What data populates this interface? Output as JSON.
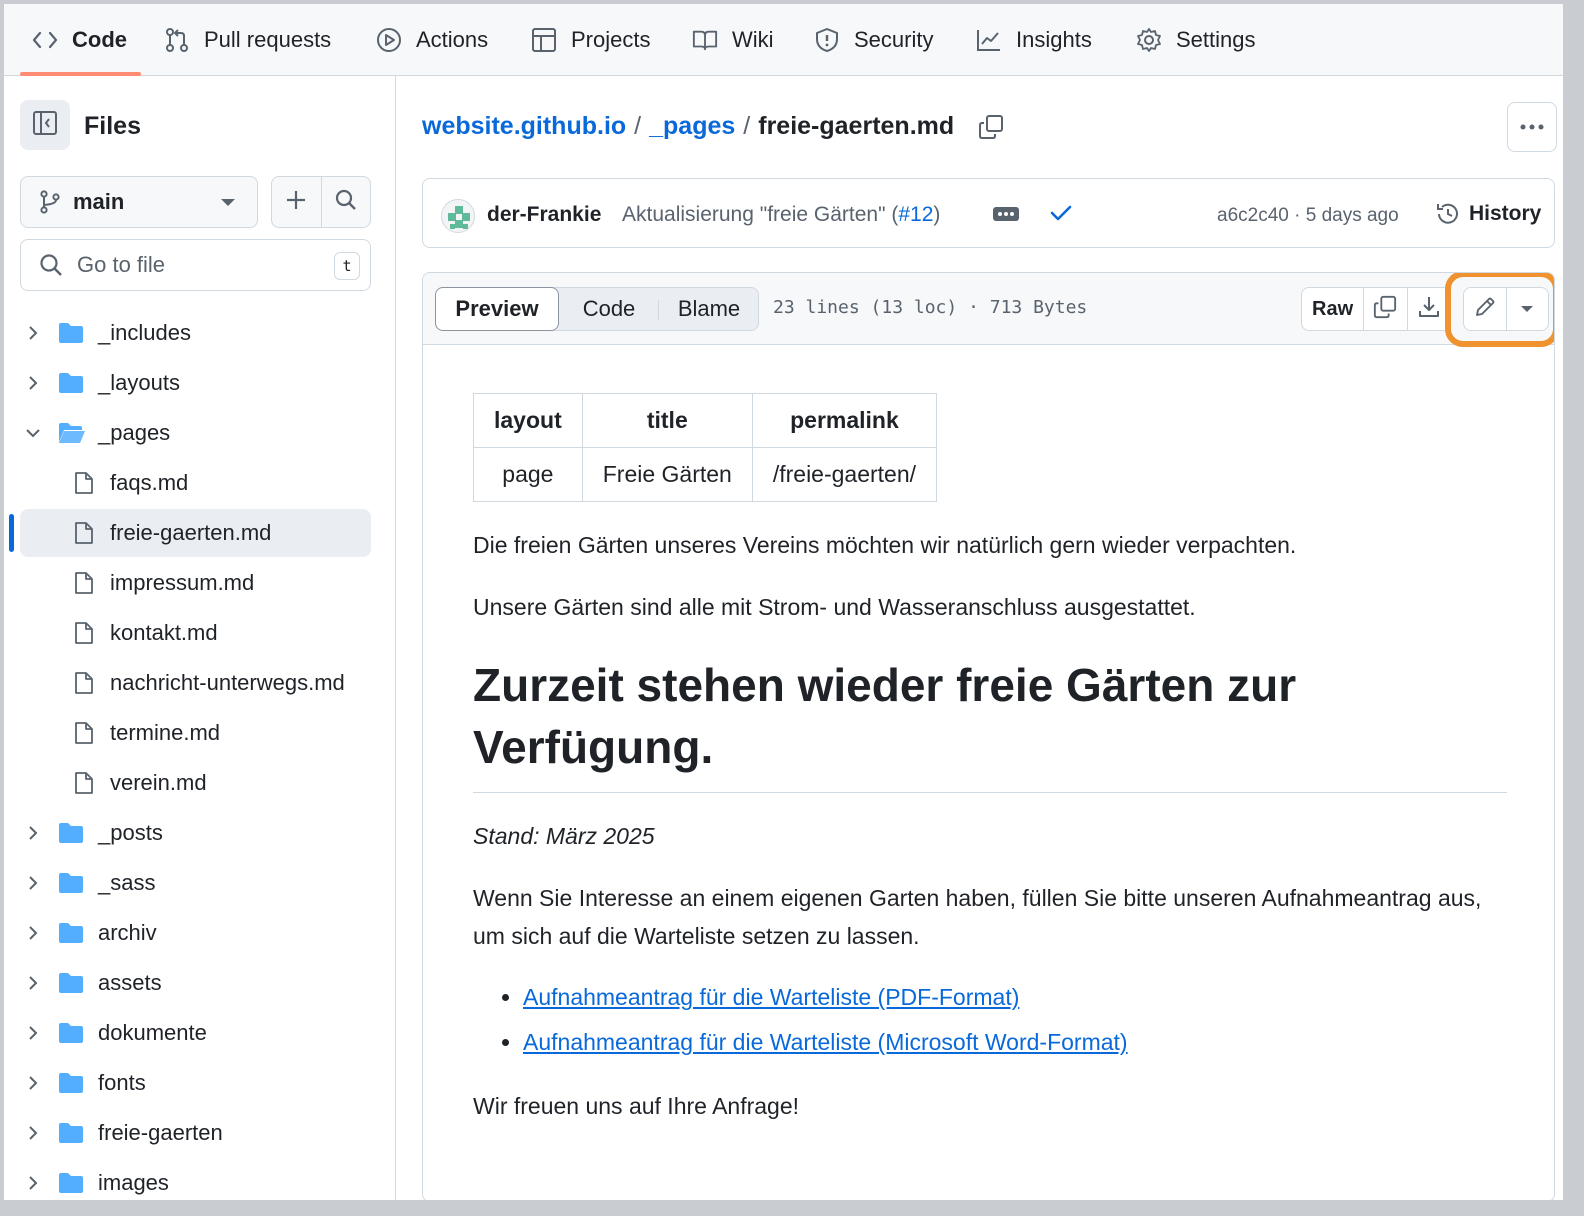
{
  "topnav": {
    "tabs": [
      {
        "label": "Code",
        "icon": "code-icon"
      },
      {
        "label": "Pull requests",
        "icon": "pull-request-icon"
      },
      {
        "label": "Actions",
        "icon": "play-icon"
      },
      {
        "label": "Projects",
        "icon": "table-icon"
      },
      {
        "label": "Wiki",
        "icon": "book-icon"
      },
      {
        "label": "Security",
        "icon": "shield-icon"
      },
      {
        "label": "Insights",
        "icon": "graph-icon"
      },
      {
        "label": "Settings",
        "icon": "gear-icon"
      }
    ]
  },
  "sidebar": {
    "title": "Files",
    "branch": "main",
    "search_placeholder": "Go to file",
    "search_shortcut": "t",
    "tree": [
      {
        "name": "_includes",
        "type": "folder",
        "expanded": false
      },
      {
        "name": "_layouts",
        "type": "folder",
        "expanded": false
      },
      {
        "name": "_pages",
        "type": "folder",
        "expanded": true
      },
      {
        "name": "faqs.md",
        "type": "file"
      },
      {
        "name": "freie-gaerten.md",
        "type": "file",
        "selected": true
      },
      {
        "name": "impressum.md",
        "type": "file"
      },
      {
        "name": "kontakt.md",
        "type": "file"
      },
      {
        "name": "nachricht-unterwegs.md",
        "type": "file"
      },
      {
        "name": "termine.md",
        "type": "file"
      },
      {
        "name": "verein.md",
        "type": "file"
      },
      {
        "name": "_posts",
        "type": "folder",
        "expanded": false
      },
      {
        "name": "_sass",
        "type": "folder",
        "expanded": false
      },
      {
        "name": "archiv",
        "type": "folder",
        "expanded": false
      },
      {
        "name": "assets",
        "type": "folder",
        "expanded": false
      },
      {
        "name": "dokumente",
        "type": "folder",
        "expanded": false
      },
      {
        "name": "fonts",
        "type": "folder",
        "expanded": false
      },
      {
        "name": "freie-gaerten",
        "type": "folder",
        "expanded": false
      },
      {
        "name": "images",
        "type": "folder",
        "expanded": false
      }
    ]
  },
  "breadcrumb": {
    "repo": "website.github.io",
    "sep": "/",
    "folder": "_pages",
    "file": "freie-gaerten.md"
  },
  "commit": {
    "author": "der-Frankie",
    "message_prefix": "Aktualisierung \"freie Gärten\" (",
    "pr_link": "#12",
    "message_suffix": ")",
    "meta": "a6c2c40 · 5 days ago",
    "history_label": "History"
  },
  "file": {
    "tabs": [
      "Preview",
      "Code",
      "Blame"
    ],
    "info": "23 lines (13 loc) · 713 Bytes",
    "raw_label": "Raw"
  },
  "content": {
    "frontmatter": {
      "headers": [
        "layout",
        "title",
        "permalink"
      ],
      "values": [
        "page",
        "Freie Gärten",
        "/freie-gaerten/"
      ]
    },
    "p1": "Die freien Gärten unseres Vereins möchten wir natürlich gern wieder verpachten.",
    "p2": "Unsere Gärten sind alle mit Strom- und Wasseranschluss ausgestattet.",
    "heading": "Zurzeit stehen wieder freie Gärten zur Verfügung.",
    "stand": "Stand: März 2025",
    "p3": "Wenn Sie Interesse an einem eigenen Garten haben, füllen Sie bitte unseren Aufnahmeantrag aus, um sich auf die Warteliste setzen zu lassen.",
    "links": [
      "Aufnahmeantrag für die Warteliste (PDF-Format)",
      "Aufnahmeantrag für die Warteliste (Microsoft Word-Format)"
    ],
    "p4": "Wir freuen uns auf Ihre Anfrage!"
  },
  "colors": {
    "accent_link": "#0969da",
    "active_tab_underline": "#fd8c73",
    "highlight_ring": "#f0922e",
    "folder": "#54aeff"
  }
}
